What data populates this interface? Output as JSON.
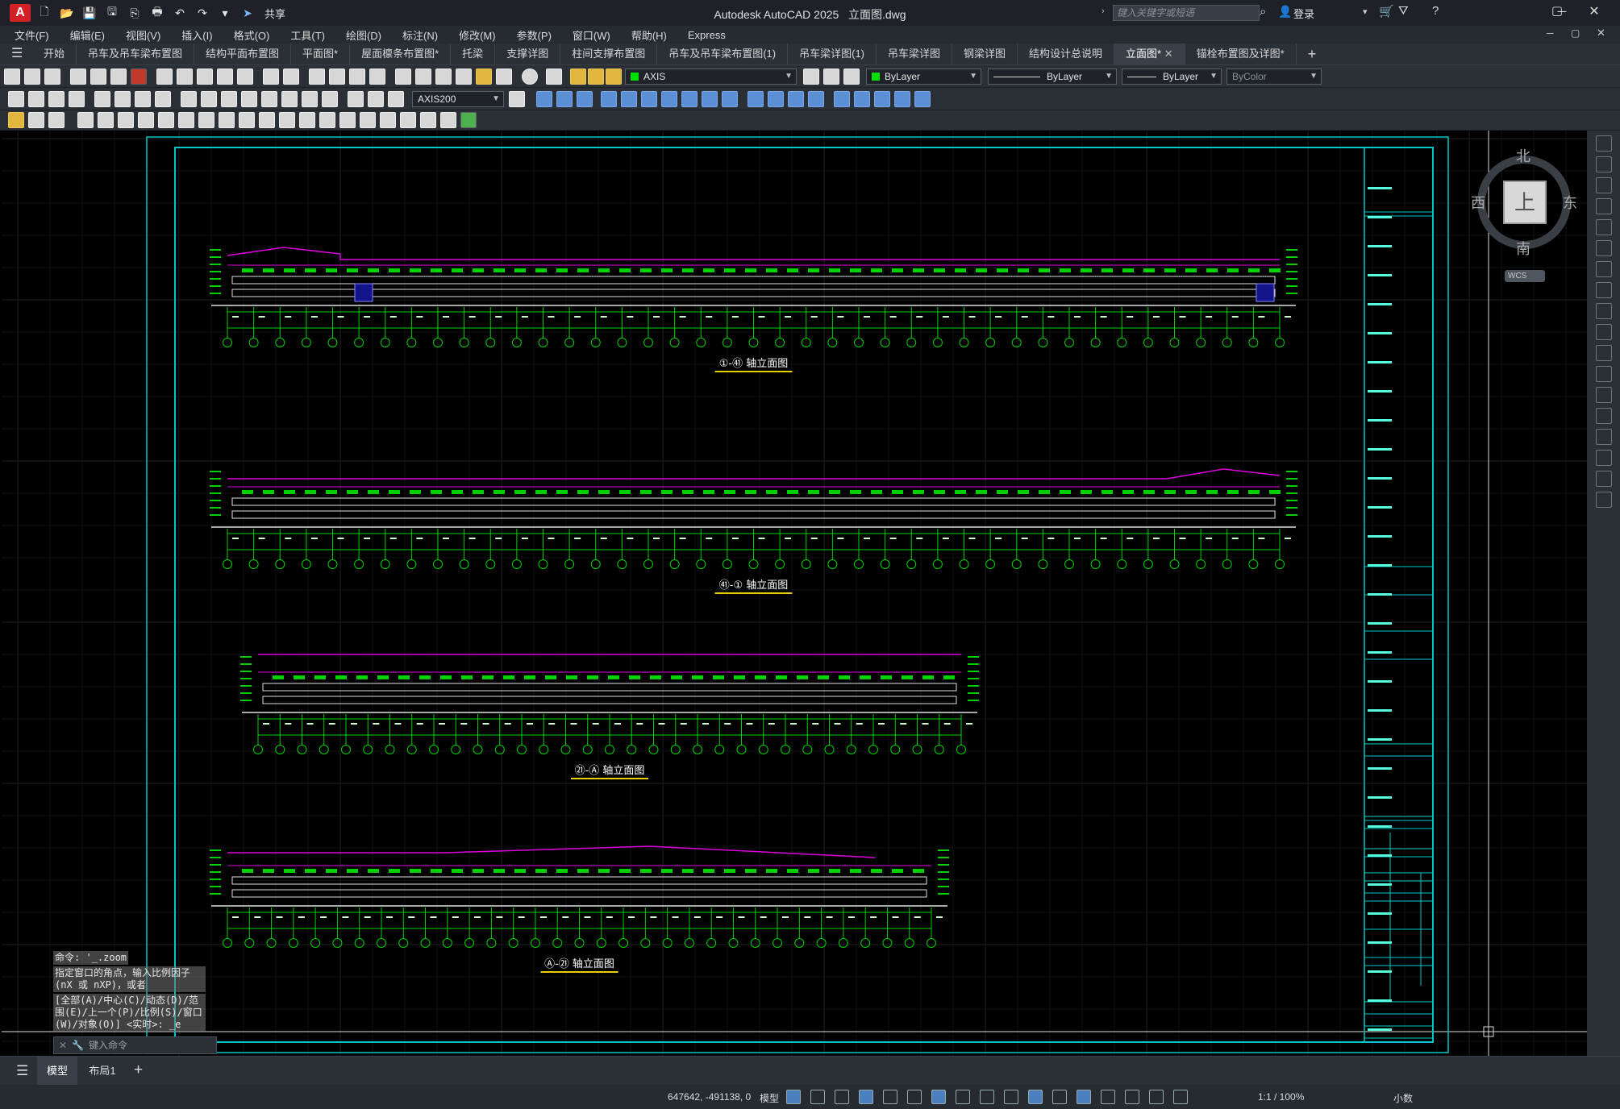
{
  "app": {
    "title": "Autodesk AutoCAD 2025",
    "file": "立面图.dwg",
    "share_label": "共享",
    "search_placeholder": "键入关键字或短语",
    "login_label": "登录",
    "logo_letter": "A"
  },
  "menu": [
    "文件(F)",
    "编辑(E)",
    "视图(V)",
    "插入(I)",
    "格式(O)",
    "工具(T)",
    "绘图(D)",
    "标注(N)",
    "修改(M)",
    "参数(P)",
    "窗口(W)",
    "帮助(H)",
    "Express"
  ],
  "tabs": [
    {
      "label": "开始"
    },
    {
      "label": "吊车及吊车梁布置图"
    },
    {
      "label": "结构平面布置图"
    },
    {
      "label": "平面图*"
    },
    {
      "label": "屋面檩条布置图*"
    },
    {
      "label": "托梁"
    },
    {
      "label": "支撑详图"
    },
    {
      "label": "柱间支撑布置图"
    },
    {
      "label": "吊车及吊车梁布置图(1)"
    },
    {
      "label": "吊车梁详图(1)"
    },
    {
      "label": "吊车梁详图"
    },
    {
      "label": "钢梁详图"
    },
    {
      "label": "结构设计总说明"
    },
    {
      "label": "立面图*",
      "active": true
    },
    {
      "label": "锚栓布置图及详图*"
    }
  ],
  "properties": {
    "layer": "AXIS",
    "color": "ByLayer",
    "linetype": "ByLayer",
    "lineweight": "ByLayer",
    "plotstyle": "ByColor",
    "dimstyle": "AXIS200"
  },
  "viewcube": {
    "north": "北",
    "south": "南",
    "west": "西",
    "east": "东",
    "face": "上",
    "wcs": "WCS"
  },
  "command": {
    "lines": [
      "命令: '_.zoom",
      "指定窗口的角点，输入比例因子 (nX 或 nXP)，或者",
      "[全部(A)/中心(C)/动态(D)/范围(E)/上一个(P)/比例(S)/窗口(W)/对象(O)] <实时>: _e"
    ],
    "input_placeholder": "键入命令"
  },
  "drawing": {
    "elevations": [
      {
        "title": "①-㊶ 轴立面图"
      },
      {
        "title": "㊶-① 轴立面图"
      },
      {
        "title": "㉑-Ⓐ 轴立面图"
      },
      {
        "title": "Ⓐ-㉑ 轴立面图"
      }
    ]
  },
  "layouts": {
    "model": "模型",
    "layout1": "布局1"
  },
  "status": {
    "coords": "647642, -491138, 0",
    "mode": "模型",
    "scale": "1:1 / 100%",
    "units": "小数"
  },
  "colors": {
    "accent_cyan": "#00c8c8",
    "magenta": "#e000e0",
    "green": "#00d000",
    "white": "#e0e0e0"
  }
}
